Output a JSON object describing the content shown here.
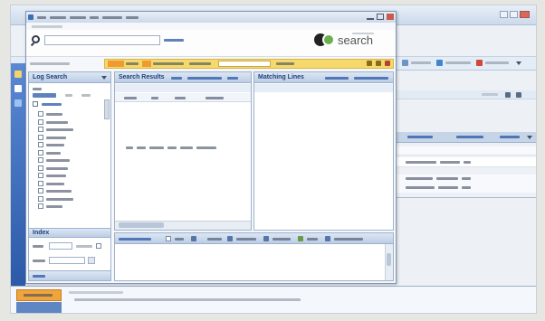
{
  "logo": {
    "text": "search"
  },
  "left_panel": {
    "title": "Log Search",
    "index_title": "Index"
  },
  "results_panel": {
    "title": "Search Results"
  },
  "matching_panel": {
    "title": "Matching Lines"
  },
  "colors": {
    "panel_header": "#c9d8ec",
    "header_text": "#1e3f7a",
    "toolbar_yellow": "#f5d96b",
    "accent_orange": "#f0a43c",
    "sidebar_blue": "#3f6fc0",
    "logo_green": "#6ab04c"
  }
}
